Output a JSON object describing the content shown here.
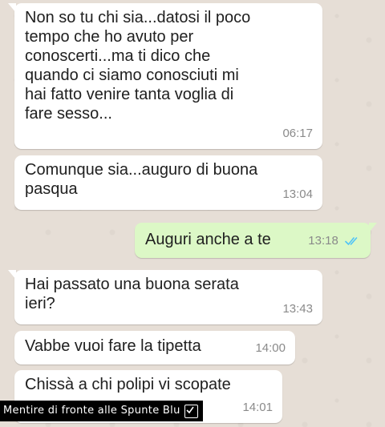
{
  "messages": [
    {
      "direction": "in",
      "text": "Non so tu chi sia...datosi il poco\ntempo che ho avuto per\nconoscerti...ma ti dico che\nquando ci siamo conosciuti mi\nhai fatto venire tanta voglia di\nfare sesso...",
      "time": "06:17"
    },
    {
      "direction": "in",
      "text": "Comunque sia...auguro di buona\npasqua",
      "time": "13:04"
    },
    {
      "direction": "out",
      "text": "Auguri anche a te",
      "time": "13:18",
      "status": "read"
    },
    {
      "direction": "in",
      "text": "Hai passato una buona serata\nieri?",
      "time": "13:43"
    },
    {
      "direction": "in",
      "text": "Vabbe vuoi fare la tipetta",
      "time": "14:00"
    },
    {
      "direction": "in",
      "text": "Chissà a chi polipi vi scopate",
      "time": "14:01"
    }
  ],
  "watermark": {
    "text": "Mentire di fronte alle Spunte Blu"
  },
  "colors": {
    "incoming_bubble": "#ffffff",
    "outgoing_bubble": "#dcf8c6",
    "read_ticks": "#4fc3f7",
    "timestamp": "#8a8a8a"
  }
}
